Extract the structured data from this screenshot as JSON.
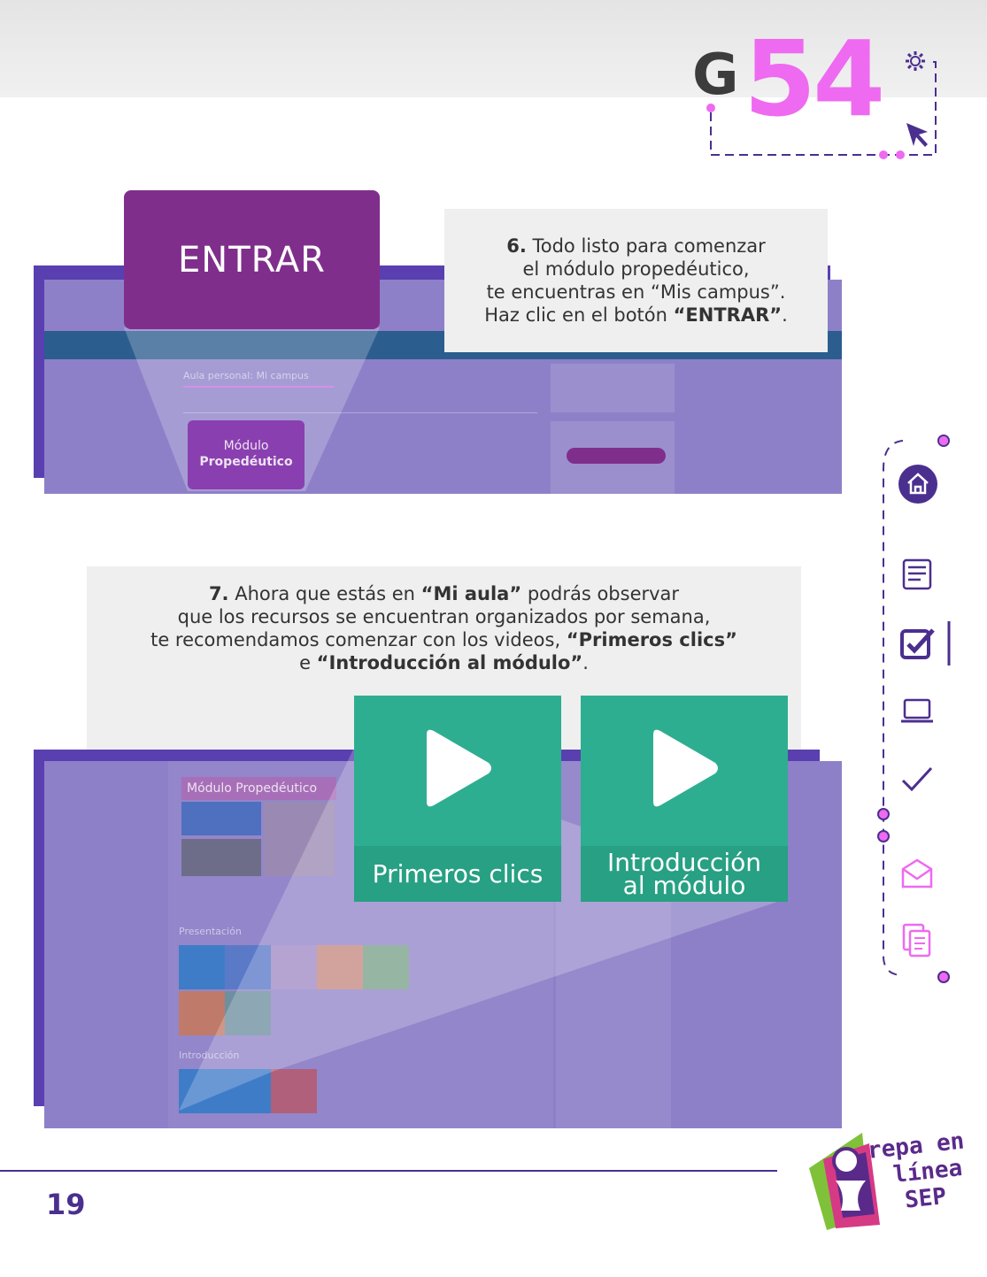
{
  "header": {
    "guide_letter": "G",
    "guide_number": "54"
  },
  "step6": {
    "number": "6.",
    "line1": "Todo listo para comenzar",
    "line2": "el módulo propedéutico,",
    "line3": "te encuentras en “Mis campus”.",
    "line4_pre": "Haz clic en el botón ",
    "line4_bold": "“ENTRAR”",
    "line4_post": "."
  },
  "entrar_button": {
    "label": "ENTRAR"
  },
  "screen1": {
    "breadcrumb": "Aula personal: Mi campus",
    "card_line1": "Módulo",
    "card_line2": "Propedéutico"
  },
  "step7": {
    "number": "7.",
    "l1_pre": " Ahora que estás en ",
    "l1_bold": "“Mi aula”",
    "l1_post": " podrás observar",
    "line2": "que los recursos se encuentran organizados por semana,",
    "l3_pre": "te recomendamos comenzar con los videos, ",
    "l3_bold": "“Primeros clics”",
    "l4_pre": "e ",
    "l4_bold": "“Introducción al módulo”",
    "l4_post": "."
  },
  "videos": [
    {
      "label": "Primeros clics"
    },
    {
      "label_line1": "Introducción",
      "label_line2": "al módulo"
    }
  ],
  "screen2": {
    "title": "Módulo Propedéutico",
    "section1": "Presentación",
    "section2": "Introducción"
  },
  "footer": {
    "page_number": "19",
    "logo_line1": "repa en",
    "logo_line2": "línea",
    "logo_line3": "SEP"
  },
  "colors": {
    "purple": "#7f2f8b",
    "navy_purple": "#4b2f8f",
    "pink": "#ee6af0",
    "green": "#2eae90",
    "overlay": "#8e80c8"
  }
}
